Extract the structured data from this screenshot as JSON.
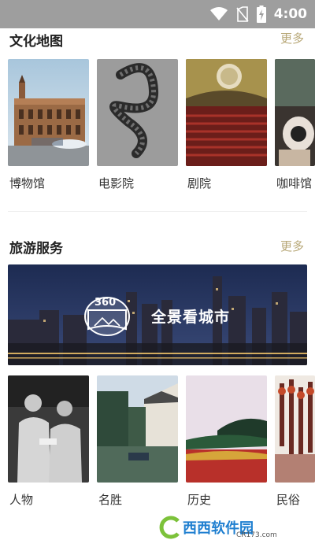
{
  "status_bar": {
    "time": "4:00",
    "icons": [
      "wifi-icon",
      "no-sim-icon",
      "battery-charging-icon"
    ]
  },
  "culture_map": {
    "title": "文化地图",
    "more": "更多",
    "items": [
      {
        "label": "博物馆"
      },
      {
        "label": "电影院"
      },
      {
        "label": "剧院"
      },
      {
        "label": "咖啡馆"
      }
    ]
  },
  "travel_services": {
    "title": "旅游服务",
    "more": "更多",
    "banner": {
      "badge": "360",
      "text": "全景看城市"
    },
    "items": [
      {
        "label": "人物"
      },
      {
        "label": "名胜"
      },
      {
        "label": "历史"
      },
      {
        "label": "民俗"
      }
    ]
  },
  "watermark": {
    "main": "西西软件园",
    "sub": "CR173.com"
  }
}
